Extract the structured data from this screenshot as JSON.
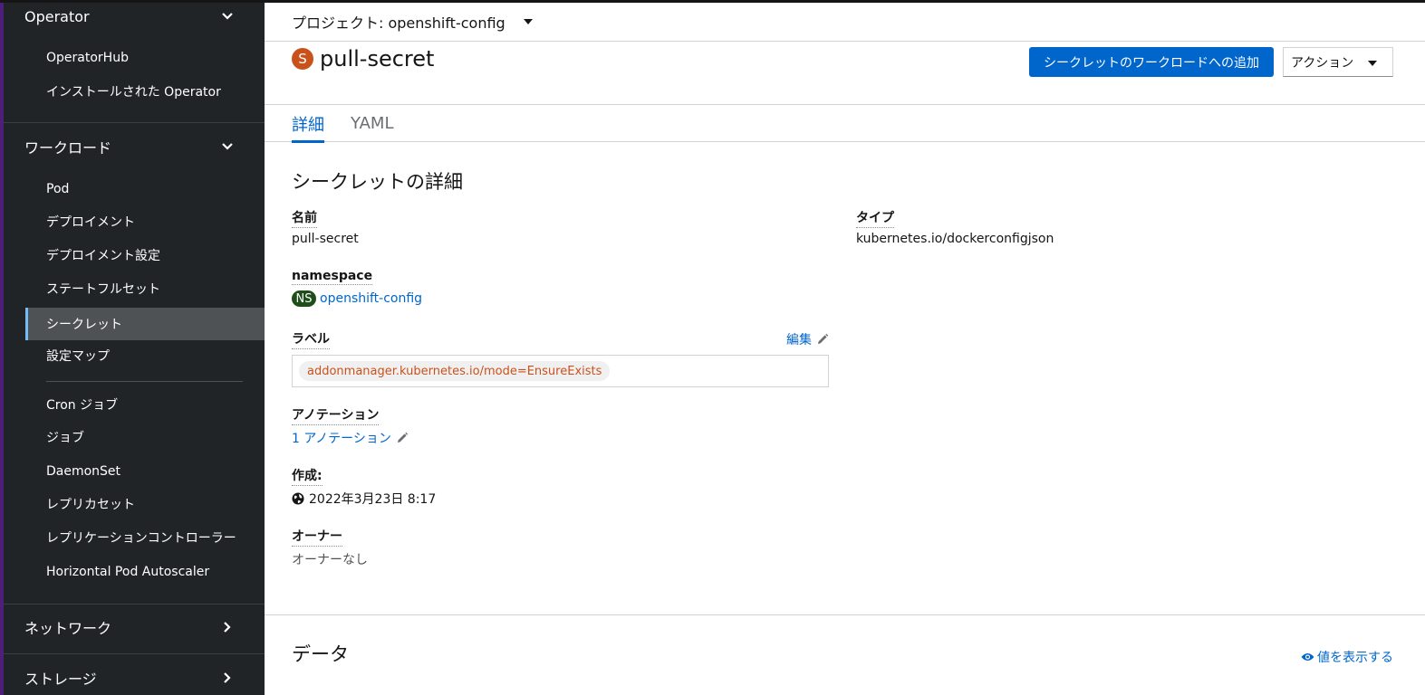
{
  "sidebar": {
    "operator": {
      "title": "Operator",
      "items": [
        "OperatorHub",
        "インストールされた Operator"
      ]
    },
    "workloads": {
      "title": "ワークロード",
      "items": [
        "Pod",
        "デプロイメント",
        "デプロイメント設定",
        "ステートフルセット",
        "シークレット",
        "設定マップ",
        "Cron ジョブ",
        "ジョブ",
        "DaemonSet",
        "レプリカセット",
        "レプリケーションコントローラー",
        "Horizontal Pod Autoscaler"
      ],
      "active": "シークレット"
    },
    "network": {
      "title": "ネットワーク"
    },
    "storage": {
      "title": "ストレージ"
    }
  },
  "project_bar": {
    "label": "プロジェクト: openshift-config"
  },
  "header": {
    "badge": "S",
    "title": "pull-secret",
    "add_button": "シークレットのワークロードへの追加",
    "actions_button": "アクション"
  },
  "tabs": [
    {
      "label": "詳細",
      "active": true
    },
    {
      "label": "YAML",
      "active": false
    }
  ],
  "details": {
    "section_title": "シークレットの詳細",
    "name_label": "名前",
    "name_value": "pull-secret",
    "namespace_label": "namespace",
    "namespace_badge": "NS",
    "namespace_value": "openshift-config",
    "labels_label": "ラベル",
    "edit_label": "編集",
    "label_chip": "addonmanager.kubernetes.io/mode=EnsureExists",
    "annotations_label": "アノテーション",
    "annotations_link": "1 アノテーション",
    "created_label": "作成:",
    "created_value": "2022年3月23日 8:17",
    "owner_label": "オーナー",
    "owner_value": "オーナーなし",
    "type_label": "タイプ",
    "type_value": "kubernetes.io/dockerconfigjson"
  },
  "data_section": {
    "title": "データ",
    "show_values": "値を表示する"
  }
}
